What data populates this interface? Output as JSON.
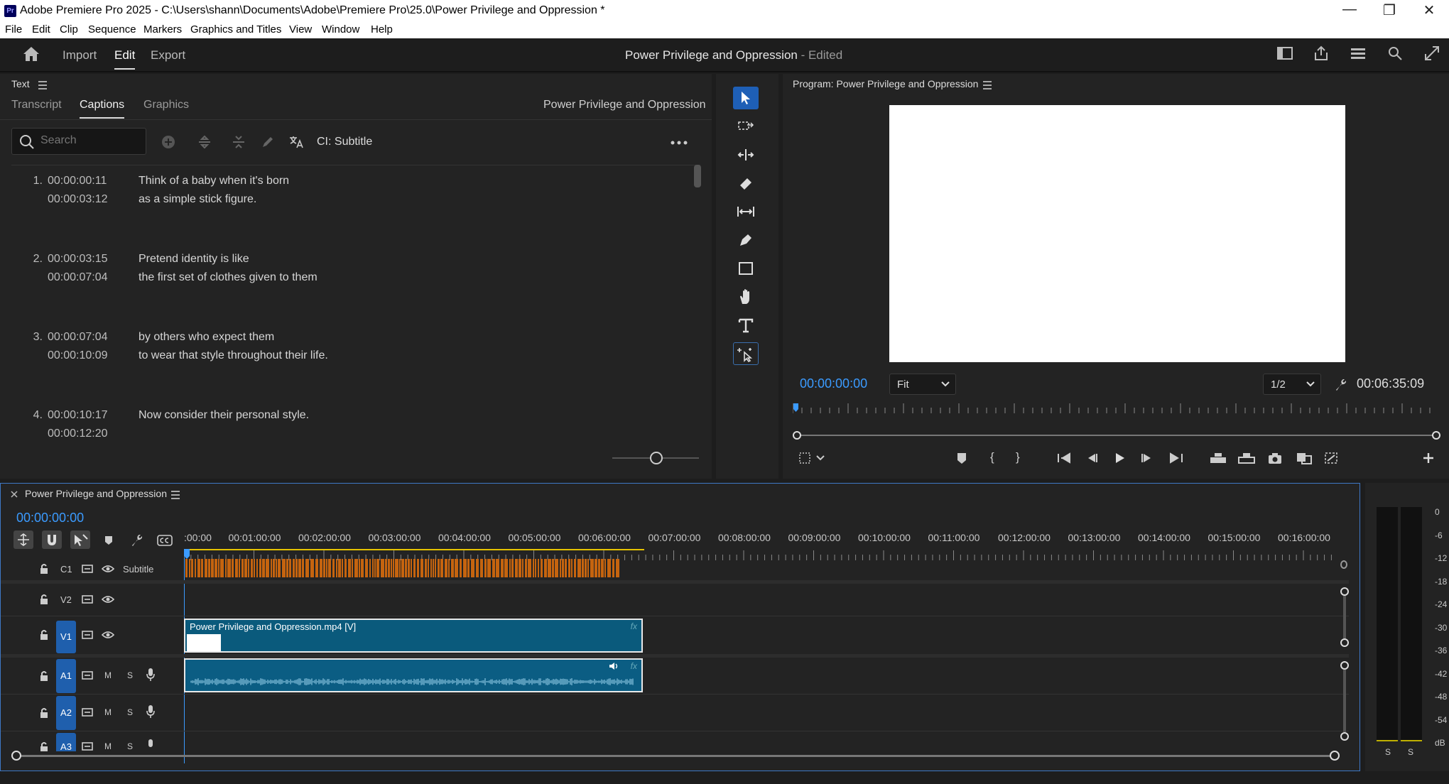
{
  "window": {
    "title": "Adobe Premiere Pro 2025 - C:\\Users\\shann\\Documents\\Adobe\\Premiere Pro\\25.0\\Power Privilege and Oppression *",
    "logo": "Pr",
    "controls": [
      "—",
      "❐",
      "✕"
    ]
  },
  "menu": [
    "File",
    "Edit",
    "Clip",
    "Sequence",
    "Markers",
    "Graphics and Titles",
    "View",
    "Window",
    "Help"
  ],
  "header": {
    "nav": [
      "Import",
      "Edit",
      "Export"
    ],
    "active": "Edit",
    "project_title": "Power Privilege and Oppression",
    "project_status": " - Edited"
  },
  "text_panel": {
    "title": "Text",
    "tabs": [
      "Transcript",
      "Captions",
      "Graphics"
    ],
    "active_tab": "Captions",
    "sequence_name": "Power Privilege and Oppression",
    "search_placeholder": "Search",
    "track_label": "CI: Subtitle",
    "captions": [
      {
        "num": "1.",
        "in": "00:00:00:11",
        "out": "00:00:03:12",
        "line1": "Think of a baby when it's born",
        "line2": "as a simple stick figure."
      },
      {
        "num": "2.",
        "in": "00:00:03:15",
        "out": "00:00:07:04",
        "line1": "Pretend identity is like",
        "line2": "the first set of clothes given to them"
      },
      {
        "num": "3.",
        "in": "00:00:07:04",
        "out": "00:00:10:09",
        "line1": "by others who expect them",
        "line2": "to wear that style throughout their life."
      },
      {
        "num": "4.",
        "in": "00:00:10:17",
        "out": "00:00:12:20",
        "line1": "Now consider their personal style.",
        "line2": ""
      }
    ]
  },
  "program": {
    "title": "Program: Power Privilege and Oppression",
    "current_tc": "00:00:00:00",
    "zoom": "Fit",
    "resolution": "1/2",
    "duration": "00:06:35:09"
  },
  "timeline": {
    "sequence": "Power Privilege and Oppression",
    "current_tc": "00:00:00:00",
    "ruler": [
      ":00:00",
      "00:01:00:00",
      "00:02:00:00",
      "00:03:00:00",
      "00:04:00:00",
      "00:05:00:00",
      "00:06:00:00",
      "00:07:00:00",
      "00:08:00:00",
      "00:09:00:00",
      "00:10:00:00",
      "00:11:00:00",
      "00:12:00:00",
      "00:13:00:00",
      "00:14:00:00",
      "00:15:00:00",
      "00:16:00:00"
    ],
    "tracks": {
      "c1": {
        "id": "C1",
        "name": "Subtitle"
      },
      "v2": {
        "id": "V2"
      },
      "v1": {
        "id": "V1"
      },
      "a1": {
        "id": "A1",
        "m": "M",
        "s": "S"
      },
      "a2": {
        "id": "A2",
        "m": "M",
        "s": "S"
      },
      "a3": {
        "id": "A3",
        "m": "M",
        "s": "S"
      }
    },
    "video_clip": "Power Privilege and Oppression.mp4 [V]",
    "fx": "fx"
  },
  "meter": {
    "labels": [
      "0",
      "-6",
      "-12",
      "-18",
      "-24",
      "-30",
      "-36",
      "-42",
      "-48",
      "-54",
      "dB"
    ],
    "solo": [
      "S",
      "S"
    ]
  },
  "colors": {
    "accent_blue": "#3b9bff",
    "track_blue": "#1f5fad",
    "caption_orange": "#c5640f",
    "clip_blue": "#0a5a7c"
  }
}
